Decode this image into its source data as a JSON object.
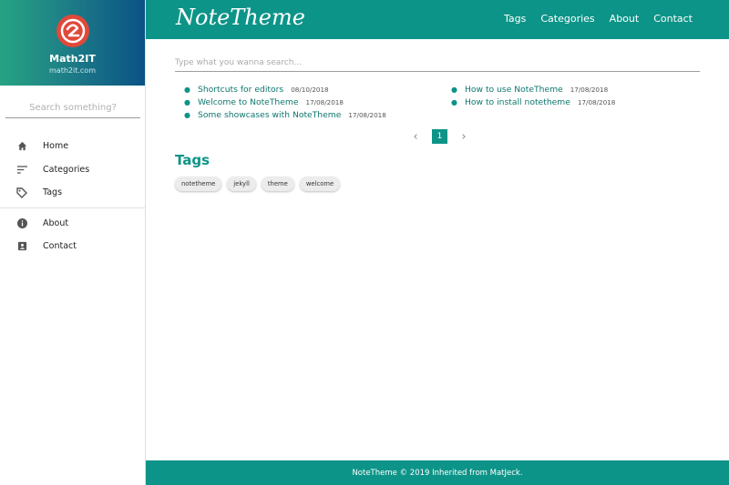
{
  "sidebar": {
    "title": "Math2IT",
    "subtitle": "math2it.com",
    "search_placeholder": "Search something?",
    "items": [
      {
        "label": "Home",
        "icon": "home-icon"
      },
      {
        "label": "Categories",
        "icon": "sort-icon"
      },
      {
        "label": "Tags",
        "icon": "tag-icon"
      },
      {
        "label": "About",
        "icon": "info-icon"
      },
      {
        "label": "Contact",
        "icon": "contact-icon"
      }
    ]
  },
  "header": {
    "brand": "NoteTheme",
    "nav": [
      "Tags",
      "Categories",
      "About",
      "Contact"
    ]
  },
  "main": {
    "search_placeholder": "Type what you wanna search...",
    "posts_left": [
      {
        "title": "Shortcuts for editors",
        "date": "08/10/2018"
      },
      {
        "title": "Welcome to NoteTheme",
        "date": "17/08/2018"
      },
      {
        "title": "Some showcases with NoteTheme",
        "date": "17/08/2018"
      }
    ],
    "posts_right": [
      {
        "title": "How to use NoteTheme",
        "date": "17/08/2018"
      },
      {
        "title": "How to install notetheme",
        "date": "17/08/2018"
      }
    ],
    "pagination": {
      "current": "1",
      "prev_icon": "chevron-left-icon",
      "next_icon": "chevron-right-icon"
    },
    "tags_heading": "Tags",
    "tags": [
      "notetheme",
      "jekyll",
      "theme",
      "welcome"
    ]
  },
  "footer": {
    "text": "NoteTheme © 2019 Inherited from MatJeck."
  },
  "colors": {
    "accent": "#0d9488",
    "logo": "#e0493a"
  }
}
